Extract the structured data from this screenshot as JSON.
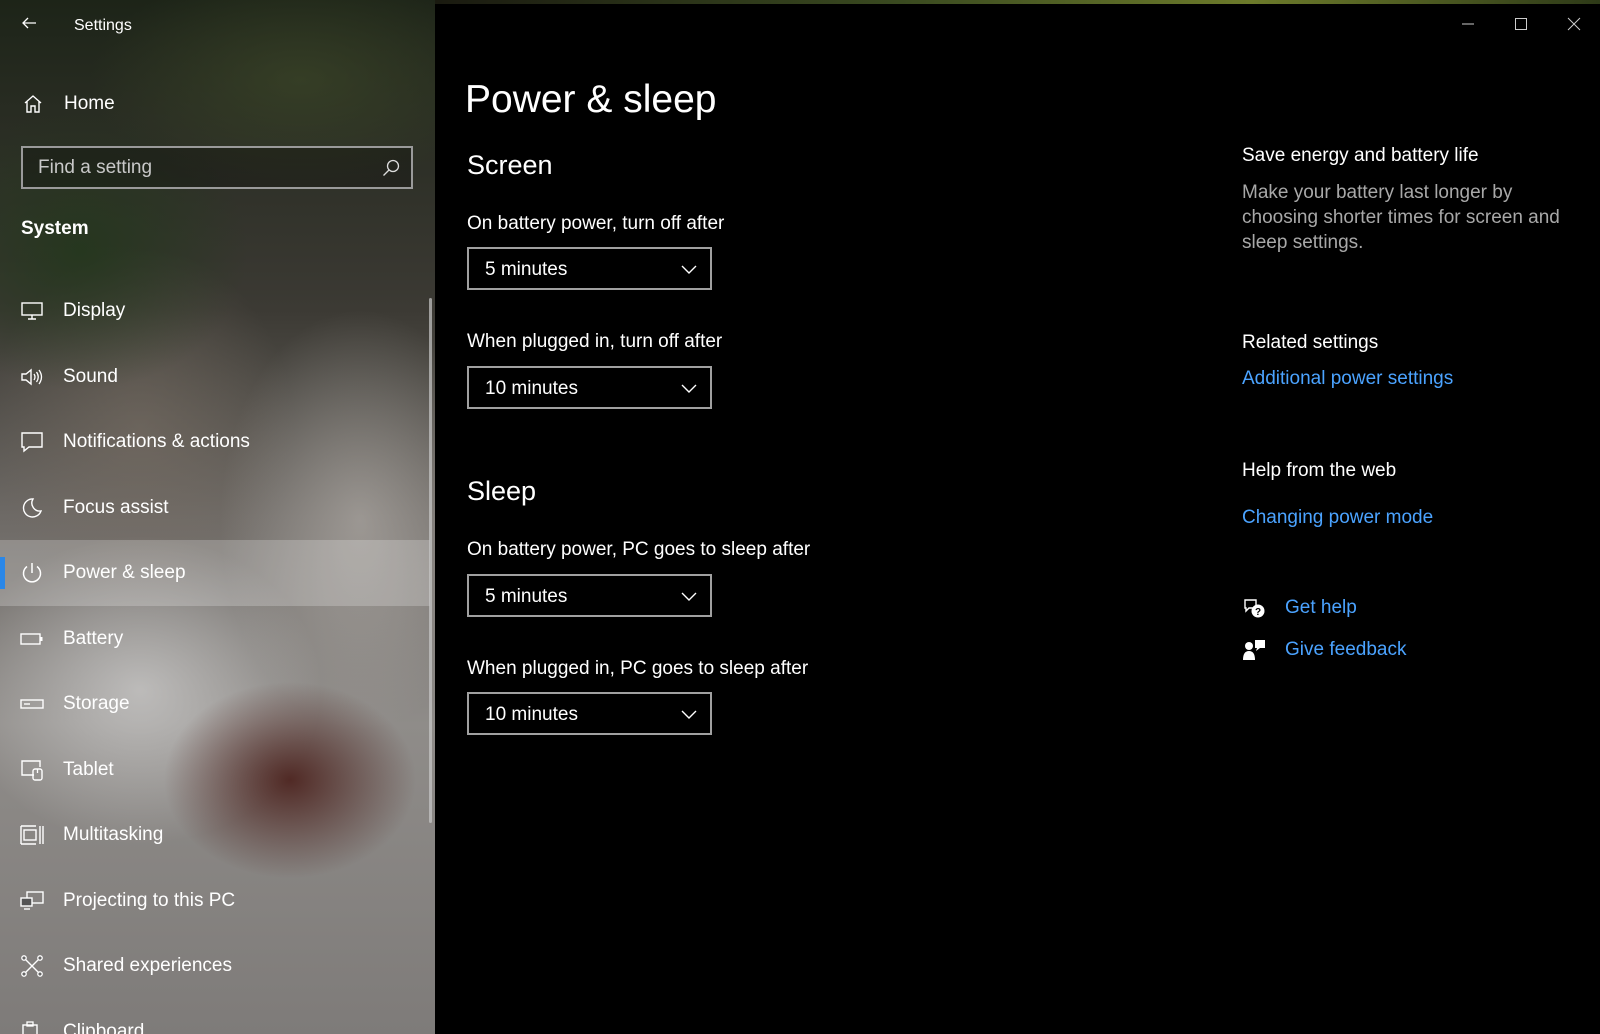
{
  "app": {
    "title": "Settings"
  },
  "sidebar": {
    "home_label": "Home",
    "search_placeholder": "Find a setting",
    "section_label": "System",
    "items": [
      {
        "label": "Display",
        "icon": "monitor-icon"
      },
      {
        "label": "Sound",
        "icon": "speaker-icon"
      },
      {
        "label": "Notifications & actions",
        "icon": "notification-icon"
      },
      {
        "label": "Focus assist",
        "icon": "moon-icon"
      },
      {
        "label": "Power & sleep",
        "icon": "power-icon",
        "selected": true
      },
      {
        "label": "Battery",
        "icon": "battery-icon"
      },
      {
        "label": "Storage",
        "icon": "storage-icon"
      },
      {
        "label": "Tablet",
        "icon": "tablet-icon"
      },
      {
        "label": "Multitasking",
        "icon": "multitasking-icon"
      },
      {
        "label": "Projecting to this PC",
        "icon": "projecting-icon"
      },
      {
        "label": "Shared experiences",
        "icon": "shared-experiences-icon"
      },
      {
        "label": "Clipboard",
        "icon": "clipboard-icon"
      }
    ]
  },
  "main": {
    "title": "Power & sleep",
    "screen": {
      "heading": "Screen",
      "battery_label": "On battery power, turn off after",
      "battery_value": "5 minutes",
      "plugged_label": "When plugged in, turn off after",
      "plugged_value": "10 minutes"
    },
    "sleep": {
      "heading": "Sleep",
      "battery_label": "On battery power, PC goes to sleep after",
      "battery_value": "5 minutes",
      "plugged_label": "When plugged in, PC goes to sleep after",
      "plugged_value": "10 minutes"
    }
  },
  "side": {
    "energy_heading": "Save energy and battery life",
    "energy_text": "Make your battery last longer by choosing shorter times for screen and sleep settings.",
    "related_heading": "Related settings",
    "related_link": "Additional power settings",
    "web_heading": "Help from the web",
    "web_link": "Changing power mode",
    "get_help": "Get help",
    "give_feedback": "Give feedback"
  },
  "colors": {
    "accent": "#2a87e8",
    "link": "#4ba3ff",
    "background": "#000000"
  }
}
